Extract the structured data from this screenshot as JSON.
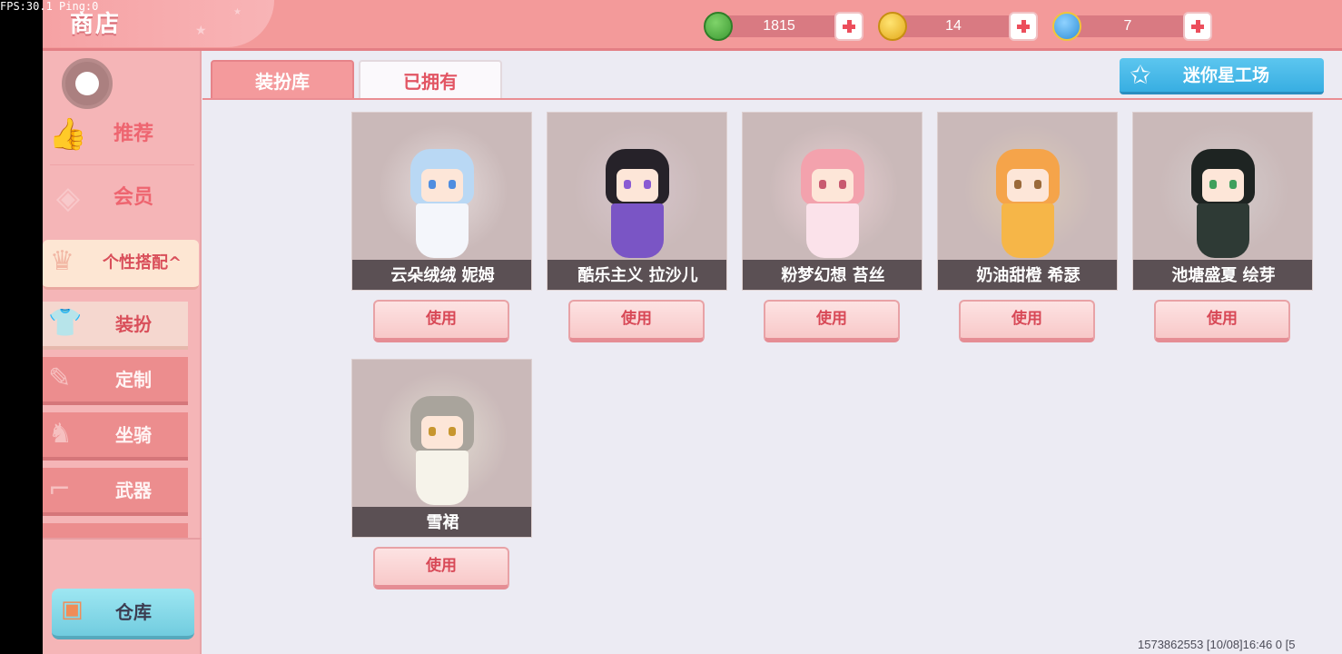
{
  "overlay": {
    "fps_text": "FPS:30.1 Ping:0"
  },
  "header": {
    "title": "商店"
  },
  "currencies": [
    {
      "name": "mini-bean",
      "value": "1815",
      "color": "#4caa3e"
    },
    {
      "name": "mini-coin",
      "value": "14",
      "color": "#f1c62b"
    },
    {
      "name": "mini-point",
      "value": "7",
      "color": "#3ba5e6"
    }
  ],
  "sidebar": {
    "items": [
      {
        "label": "推荐",
        "icon": "thumbs-up-icon"
      },
      {
        "label": "会员",
        "icon": "vip-card-icon"
      }
    ],
    "style_group": {
      "label": "个性搭配^",
      "icon": "trophy-icon"
    },
    "sub_items": [
      {
        "label": "装扮",
        "icon": "shirt-icon",
        "active": true
      },
      {
        "label": "定制",
        "icon": "brush-icon",
        "active": false
      },
      {
        "label": "坐骑",
        "icon": "mount-icon",
        "active": false
      },
      {
        "label": "武器",
        "icon": "gun-icon",
        "active": false
      }
    ],
    "warehouse": {
      "label": "仓库",
      "icon": "chest-icon"
    }
  },
  "tabs": [
    {
      "label": "装扮库",
      "active": false
    },
    {
      "label": "已拥有",
      "active": true
    }
  ],
  "workshop": {
    "label": "迷你星工场",
    "icon": "star-icon"
  },
  "skins": [
    {
      "name": "云朵绒绒 妮姆",
      "button": "使用",
      "hair": "#b9d8f4",
      "dress": "#f4f6fb",
      "eye": "#4f8de0",
      "glow": "#e6dcdc"
    },
    {
      "name": "酷乐主义 拉沙儿",
      "button": "使用",
      "hair": "#262229",
      "dress": "#7a55c5",
      "eye": "#8a5bd3",
      "glow": "#d7c6cc"
    },
    {
      "name": "粉梦幻想 苔丝",
      "button": "使用",
      "hair": "#f3a2ad",
      "dress": "#fbe2ea",
      "eye": "#c85a70",
      "glow": "#e8cfd2"
    },
    {
      "name": "奶油甜橙 希瑟",
      "button": "使用",
      "hair": "#f5a44a",
      "dress": "#f6b648",
      "eye": "#9b6a3a",
      "glow": "#dccbb9"
    },
    {
      "name": "池塘盛夏 绘芽",
      "button": "使用",
      "hair": "#1e2422",
      "dress": "#2e3a35",
      "eye": "#3f9f5c",
      "glow": "#d4cccc"
    },
    {
      "name": "雪裙",
      "button": "使用",
      "hair": "#a9a49c",
      "dress": "#f6f3ea",
      "eye": "#c7962f",
      "glow": "#e2dcd2"
    }
  ],
  "footer": {
    "text": "1573862553   [10/08]16:46 0   [5"
  }
}
